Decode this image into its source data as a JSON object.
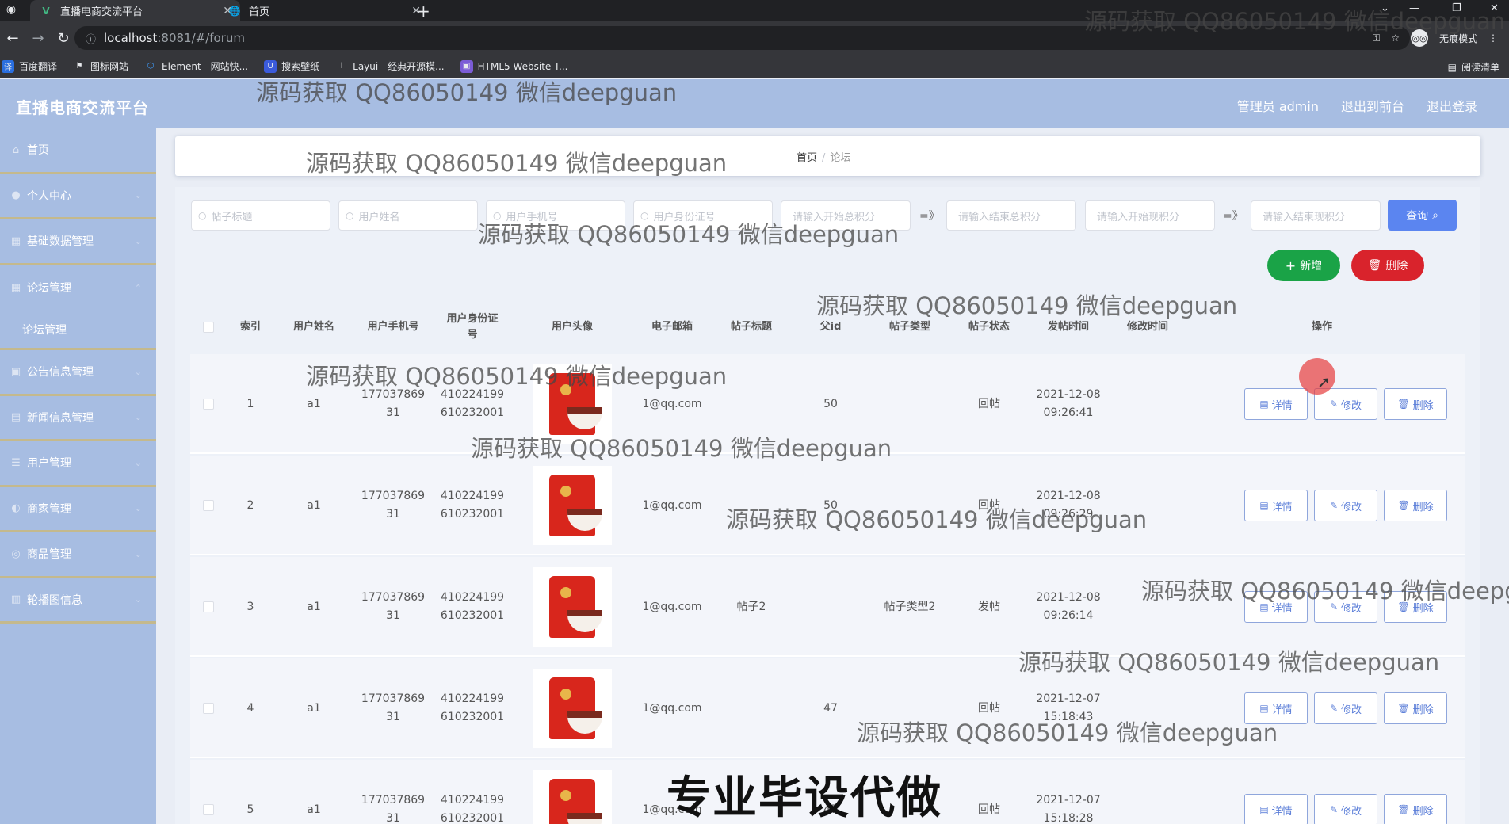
{
  "browser": {
    "tabs": [
      {
        "title": "直播电商交流平台",
        "active": true
      },
      {
        "title": "首页",
        "active": false
      }
    ],
    "url_host": "localhost",
    "url_path": ":8081/#/forum",
    "incognito_label": "无痕模式",
    "reading_list": "阅读清单",
    "bookmarks": [
      "百度翻译",
      "图标网站",
      "Element - 网站快...",
      "搜索壁纸",
      "Layui - 经典开源模...",
      "HTML5 Website T..."
    ]
  },
  "app": {
    "title": "直播电商交流平台",
    "top_links": [
      "管理员 admin",
      "退出到前台",
      "退出登录"
    ]
  },
  "sidebar": {
    "items": [
      {
        "label": "首页",
        "icon": "home-icon"
      },
      {
        "label": "个人中心",
        "icon": "user-icon"
      },
      {
        "label": "基础数据管理",
        "icon": "grid-icon"
      },
      {
        "label": "论坛管理",
        "icon": "forum-icon"
      },
      {
        "label": "论坛管理",
        "icon": "",
        "sub": true
      },
      {
        "label": "公告信息管理",
        "icon": "notice-icon"
      },
      {
        "label": "新闻信息管理",
        "icon": "news-icon"
      },
      {
        "label": "用户管理",
        "icon": "list-icon"
      },
      {
        "label": "商家管理",
        "icon": "shop-icon"
      },
      {
        "label": "商品管理",
        "icon": "goods-icon"
      },
      {
        "label": "轮播图信息",
        "icon": "image-icon"
      }
    ]
  },
  "breadcrumb": {
    "home": "首页",
    "current": "论坛"
  },
  "search": {
    "post_title_ph": "帖子标题",
    "user_name_ph": "用户姓名",
    "user_phone_ph": "用户手机号",
    "user_id_ph": "用户身份证号",
    "total_start_ph": "请输入开始总积分",
    "total_end_ph": "请输入结束总积分",
    "cur_start_ph": "请输入开始现积分",
    "cur_end_ph": "请输入结束现积分",
    "range_sep": "=》",
    "query_label": "查询"
  },
  "actions": {
    "add_label": "新增",
    "delete_label": "删除"
  },
  "table": {
    "headers": [
      "索引",
      "用户姓名",
      "用户手机号",
      "用户身份证号",
      "用户头像",
      "电子邮箱",
      "帖子标题",
      "父id",
      "帖子类型",
      "帖子状态",
      "发帖时间",
      "修改时间",
      "操作"
    ],
    "op_labels": {
      "detail": "详情",
      "edit": "修改",
      "delete": "删除"
    },
    "rows": [
      {
        "index": "1",
        "name": "a1",
        "phone1": "177037869",
        "phone2": "31",
        "id1": "410224199",
        "id2": "610232001",
        "email": "1@qq.com",
        "title": "",
        "parent_id": "50",
        "type": "",
        "status": "回帖",
        "time1": "2021-12-08",
        "time2": "09:26:41",
        "modified": ""
      },
      {
        "index": "2",
        "name": "a1",
        "phone1": "177037869",
        "phone2": "31",
        "id1": "410224199",
        "id2": "610232001",
        "email": "1@qq.com",
        "title": "",
        "parent_id": "50",
        "type": "",
        "status": "回帖",
        "time1": "2021-12-08",
        "time2": "09:26:29",
        "modified": ""
      },
      {
        "index": "3",
        "name": "a1",
        "phone1": "177037869",
        "phone2": "31",
        "id1": "410224199",
        "id2": "610232001",
        "email": "1@qq.com",
        "title": "帖子2",
        "parent_id": "",
        "type": "帖子类型2",
        "status": "发帖",
        "time1": "2021-12-08",
        "time2": "09:26:14",
        "modified": ""
      },
      {
        "index": "4",
        "name": "a1",
        "phone1": "177037869",
        "phone2": "31",
        "id1": "410224199",
        "id2": "610232001",
        "email": "1@qq.com",
        "title": "",
        "parent_id": "47",
        "type": "",
        "status": "回帖",
        "time1": "2021-12-07",
        "time2": "15:18:43",
        "modified": ""
      },
      {
        "index": "5",
        "name": "a1",
        "phone1": "177037869",
        "phone2": "31",
        "id1": "410224199",
        "id2": "610232001",
        "email": "1@qq.com",
        "title": "",
        "parent_id": "47",
        "type": "",
        "status": "回帖",
        "time1": "2021-12-07",
        "time2": "15:18:28",
        "modified": ""
      }
    ]
  },
  "overlay": {
    "watermark": "源码获取 QQ86050149 微信deepguan",
    "banner": "专业毕设代做"
  }
}
